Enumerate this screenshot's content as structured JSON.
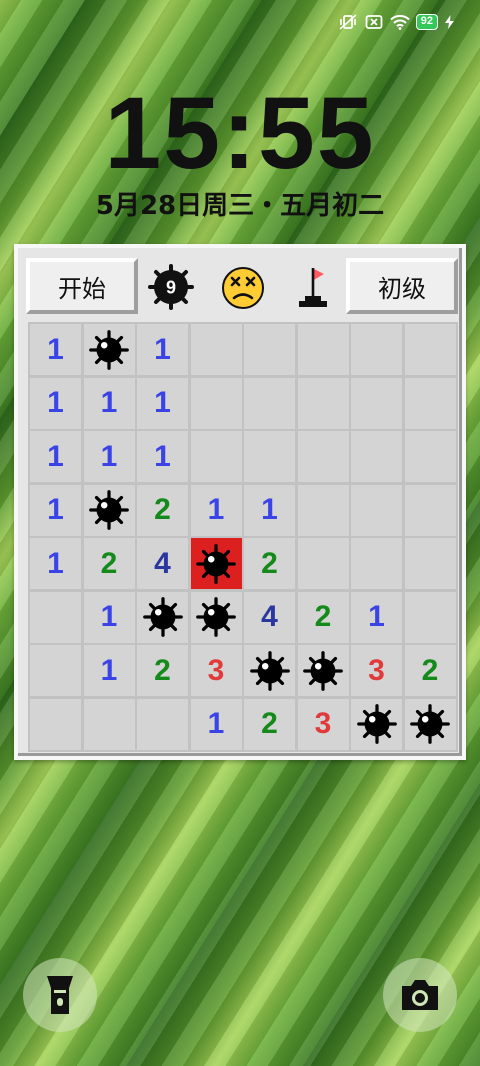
{
  "status_bar": {
    "battery": "92",
    "icons": [
      "vibrate-icon",
      "no-sim-icon",
      "wifi-icon",
      "battery-icon",
      "charging-icon"
    ]
  },
  "lockscreen": {
    "time": "15:55",
    "date": "5月28日周三・五月初二"
  },
  "game": {
    "start_button": "开始",
    "level_button": "初级",
    "mine_counter": "9",
    "face_state": "dead",
    "board": [
      [
        "1",
        "M",
        "1",
        "",
        "",
        "",
        "",
        ""
      ],
      [
        "1",
        "1",
        "1",
        "",
        "",
        "",
        "",
        ""
      ],
      [
        "1",
        "1",
        "1",
        "",
        "",
        "",
        "",
        ""
      ],
      [
        "1",
        "M",
        "2",
        "1",
        "1",
        "",
        "",
        ""
      ],
      [
        "1",
        "2",
        "4",
        "X",
        "2",
        "",
        "",
        ""
      ],
      [
        "",
        "1",
        "M",
        "M",
        "4",
        "2",
        "1",
        ""
      ],
      [
        "",
        "1",
        "2",
        "3",
        "M",
        "M",
        "3",
        "2"
      ],
      [
        "",
        "",
        "",
        "1",
        "2",
        "3",
        "M",
        "M"
      ]
    ],
    "number_colors": {
      "1": "#3a43e6",
      "2": "#138a1a",
      "3": "#e03a3a",
      "4": "#2b37a0"
    },
    "exploded_color": "#dc1f1f"
  },
  "shortcuts": {
    "left": "flashlight-icon",
    "right": "camera-icon"
  }
}
